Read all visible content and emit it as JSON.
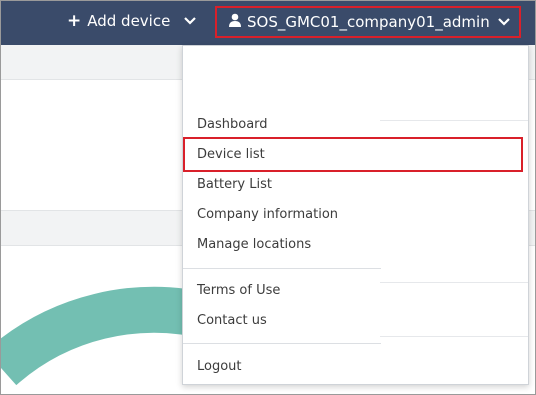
{
  "header": {
    "add_device_label": "Add device",
    "user_label": "SOS_GMC01_company01_admin"
  },
  "menu": {
    "items": [
      {
        "label": "Dashboard"
      },
      {
        "label": "Device list"
      },
      {
        "label": "Battery List"
      },
      {
        "label": "Company information"
      },
      {
        "label": "Manage locations"
      },
      {
        "label": "Terms of Use"
      },
      {
        "label": "Contact us"
      },
      {
        "label": "Logout"
      }
    ],
    "highlighted": "Device list"
  },
  "colors": {
    "topbar": "#3a4b6a",
    "highlight_border": "#d9202a",
    "donut_arc": "#73bfb2"
  }
}
